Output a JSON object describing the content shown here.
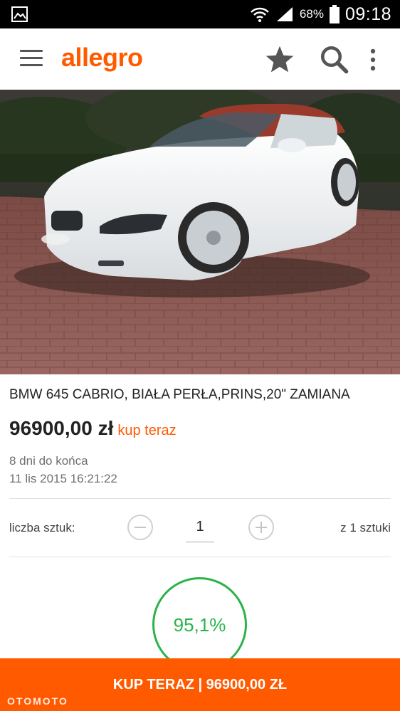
{
  "status_bar": {
    "battery_percent": "68%",
    "time": "09:18"
  },
  "app_bar": {
    "logo": "allegro",
    "icons": [
      "menu-icon",
      "star-icon",
      "search-icon",
      "more-vert-icon"
    ]
  },
  "listing": {
    "title": "BMW 645 CABRIO, BIAŁA PERŁA,PRINS,20\" ZAMIANA",
    "price": "96900,00 zł",
    "buy_now_label": "kup teraz",
    "time_left": "8 dni do końca",
    "end_date": "11 lis 2015 16:21:22"
  },
  "quantity": {
    "label": "liczba sztuk:",
    "value": "1",
    "available": "z 1 sztuki"
  },
  "seller_rating": {
    "percent": "95,1%"
  },
  "buy_bar": {
    "label": "KUP TERAZ | 96900,00 ZŁ"
  },
  "watermark": "OTOMOTO",
  "colors": {
    "brand_orange": "#ff5a00",
    "rating_green": "#2bb34a",
    "status_bar": "#000000"
  }
}
